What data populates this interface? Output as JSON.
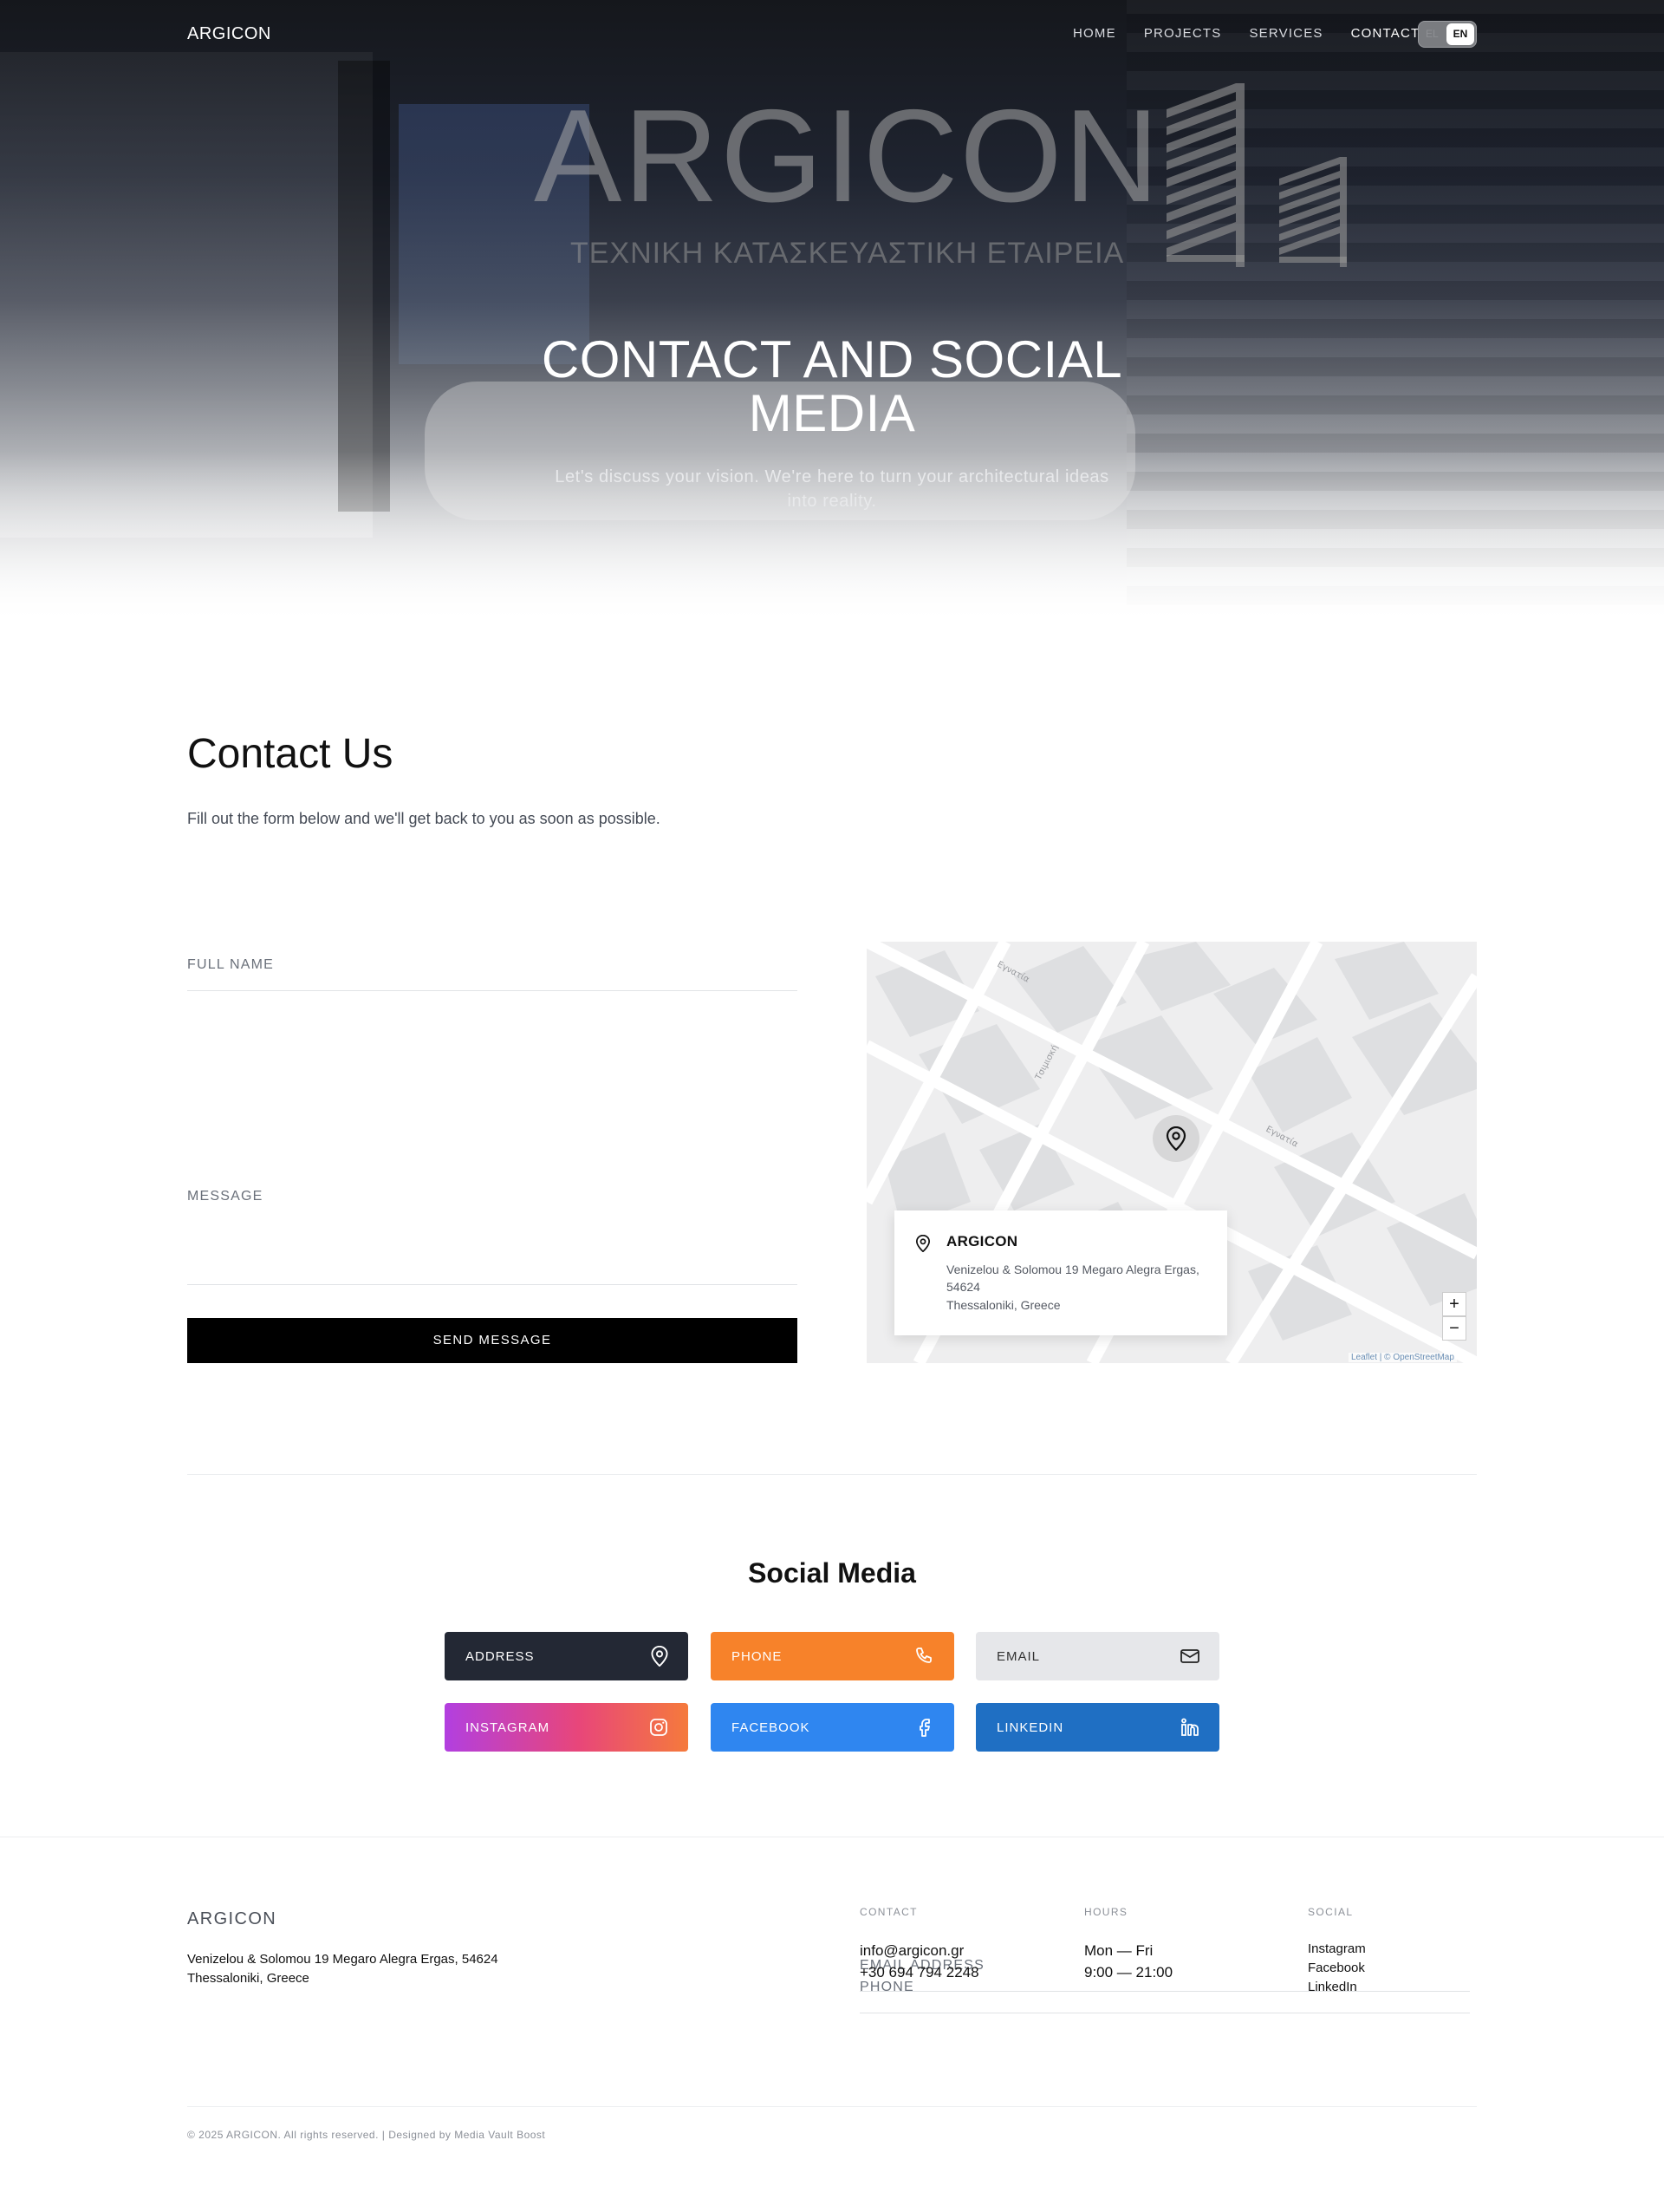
{
  "nav": {
    "brand": "ARGICON",
    "links": [
      "HOME",
      "PROJECTS",
      "SERVICES",
      "CONTACT"
    ],
    "active": "CONTACT",
    "lang_options": [
      "EL",
      "EN"
    ],
    "lang_selected": "EN"
  },
  "hero": {
    "logo_word": "ARGICON",
    "logo_sub": "ΤΕΧΝΙΚΗ ΚΑΤΑΣΚΕΥΑΣΤΙΚΗ ΕΤΑΙΡΕΙΑ",
    "title": "CONTACT AND SOCIAL MEDIA",
    "subtitle": "Let's discuss your vision. We're here to turn your architectural ideas into reality."
  },
  "contact": {
    "title": "Contact Us",
    "description": "Fill out the form below and we'll get back to you as soon as possible.",
    "fields": {
      "full_name": "FULL NAME",
      "email": "EMAIL ADDRESS",
      "phone": "PHONE",
      "message": "MESSAGE"
    },
    "submit_label": "SEND MESSAGE"
  },
  "map": {
    "card_name": "ARGICON",
    "card_address": "Venizelou & Solomou 19 Megaro Alegra Ergas, 54624",
    "card_city": "Thessaloniki, Greece",
    "zoom_in": "+",
    "zoom_out": "−",
    "attribution": "Leaflet | © OpenStreetMap"
  },
  "social": {
    "title": "Social Media",
    "buttons": {
      "address": "ADDRESS",
      "phone": "PHONE",
      "email": "EMAIL",
      "instagram": "INSTAGRAM",
      "facebook": "FACEBOOK",
      "linkedin": "LINKEDIN"
    },
    "colors": {
      "address": "#232834",
      "phone": "#f7822a",
      "email": "#e6e7ea",
      "facebook": "#2f86f0",
      "linkedin": "#1f6fc3"
    }
  },
  "footer": {
    "brand": "ARGICON",
    "address_line1": "Venizelou & Solomou 19 Megaro Alegra Ergas, 54624",
    "address_line2": "Thessaloniki, Greece",
    "contact_heading": "CONTACT",
    "email": "info@argicon.gr",
    "phone": "+30 694 794 2248",
    "hours_heading": "HOURS",
    "days": "Mon — Fri",
    "time": "9:00 — 21:00",
    "social_heading": "SOCIAL",
    "social_links": [
      "Instagram",
      "Facebook",
      "LinkedIn"
    ],
    "copyright": "© 2025 ARGICON. All rights reserved. | Designed by Media Vault Boost"
  }
}
